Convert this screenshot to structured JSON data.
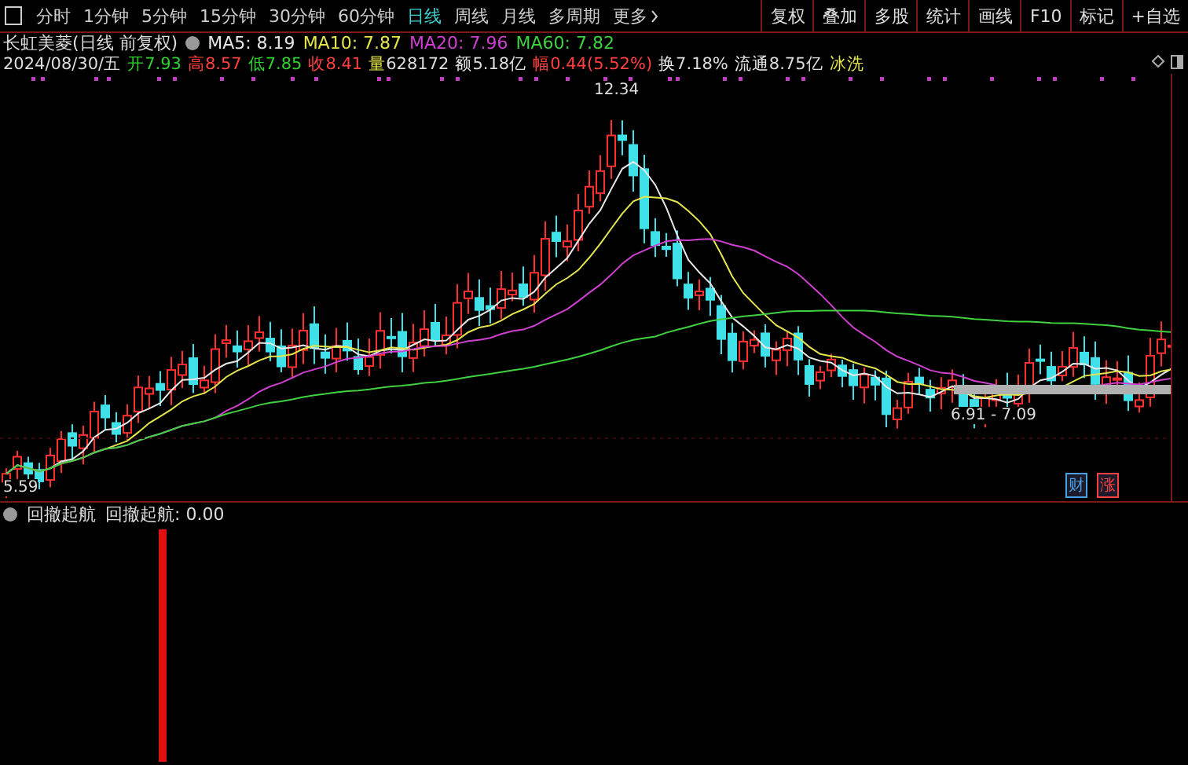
{
  "toolbar": {
    "periods": [
      {
        "label": "分时",
        "selected": false
      },
      {
        "label": "1分钟",
        "selected": false
      },
      {
        "label": "5分钟",
        "selected": false
      },
      {
        "label": "15分钟",
        "selected": false
      },
      {
        "label": "30分钟",
        "selected": false
      },
      {
        "label": "60分钟",
        "selected": false
      },
      {
        "label": "日线",
        "selected": true
      },
      {
        "label": "周线",
        "selected": false
      },
      {
        "label": "月线",
        "selected": false
      },
      {
        "label": "多周期",
        "selected": false
      },
      {
        "label": "更多",
        "selected": false
      }
    ],
    "actions": [
      "复权",
      "叠加",
      "多股",
      "统计",
      "画线",
      "F10",
      "标记",
      "+自选"
    ]
  },
  "chart_header": {
    "title": "长虹美菱(日线 前复权)",
    "moving_averages": [
      {
        "label": "MA5: 8.19",
        "color": "#e8e8e8"
      },
      {
        "label": "MA10: 7.87",
        "color": "#e6e64c"
      },
      {
        "label": "MA20: 7.96",
        "color": "#d040d0"
      },
      {
        "label": "MA60: 7.82",
        "color": "#40d040"
      }
    ]
  },
  "quote": {
    "date": "2024/08/30/五",
    "items": [
      {
        "label": "开",
        "value": "7.93",
        "color": "#30d030"
      },
      {
        "label": "高",
        "value": "8.57",
        "color": "#ff4040"
      },
      {
        "label": "低",
        "value": "7.85",
        "color": "#30d030"
      },
      {
        "label": "收",
        "value": "8.41",
        "color": "#ff4040"
      },
      {
        "label": "量",
        "value": "628172",
        "color": "#e6e64c"
      },
      {
        "label": "额",
        "value": "5.18亿",
        "color": "#e8e8e8"
      },
      {
        "label": "幅",
        "value": "0.44(5.52%)",
        "color": "#ff4040"
      },
      {
        "label": "换",
        "value": "7.18%",
        "color": "#e8e8e8"
      },
      {
        "label": "流通",
        "value": "8.75亿",
        "color": "#e8e8e8"
      }
    ],
    "tag": "冰洗"
  },
  "price_chart": {
    "high_label": "12.34",
    "range_label": "6.91 - 7.09",
    "low_label": "5.59",
    "event_markers": [
      {
        "label": "财",
        "color": "#4aa0e0"
      },
      {
        "label": "涨",
        "color": "#ff4040"
      }
    ]
  },
  "indicator": {
    "name": "回撤起航",
    "reading": "回撤起航: 0.00"
  }
}
